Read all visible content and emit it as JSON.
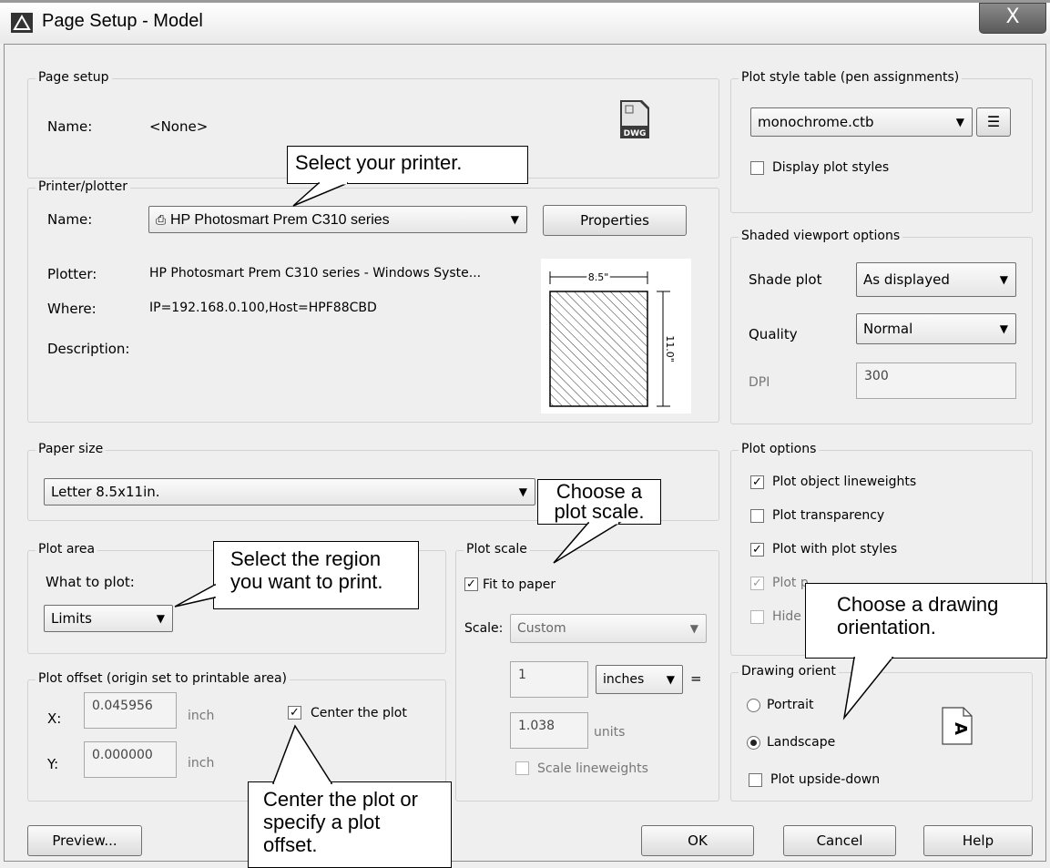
{
  "window": {
    "title": "Page Setup - Model",
    "close_label": "X"
  },
  "page_setup": {
    "legend": "Page setup",
    "name_label": "Name:",
    "name_value": "<None>",
    "dwg_label": "DWG"
  },
  "printer": {
    "legend": "Printer/plotter",
    "name_label": "Name:",
    "name_value": "HP Photosmart Prem C310 series",
    "properties_label": "Properties",
    "plotter_label": "Plotter:",
    "plotter_value": "HP Photosmart Prem C310 series - Windows Syste...",
    "where_label": "Where:",
    "where_value": "IP=192.168.0.100,Host=HPF88CBD",
    "description_label": "Description:",
    "preview_width": "8.5\"",
    "preview_height": "11.0\""
  },
  "paper_size": {
    "legend": "Paper size",
    "value": "Letter 8.5x11in."
  },
  "plot_area": {
    "legend": "Plot area",
    "what_label": "What to plot:",
    "value": "Limits"
  },
  "plot_offset": {
    "legend": "Plot offset (origin set to printable area)",
    "x_label": "X:",
    "x_value": "0.045956",
    "x_unit": "inch",
    "y_label": "Y:",
    "y_value": "0.000000",
    "y_unit": "inch",
    "center_label": "Center the plot",
    "center_checked": true
  },
  "plot_scale": {
    "legend": "Plot scale",
    "fit_label": "Fit to paper",
    "scale_label": "Scale:",
    "scale_value": "Custom",
    "num_value": "1",
    "unit_value": "inches",
    "equals": "=",
    "den_value": "1.038",
    "den_unit": "units",
    "lineweights_label": "Scale lineweights"
  },
  "plot_style_table": {
    "legend": "Plot style table (pen assignments)",
    "value": "monochrome.ctb",
    "display_label": "Display plot styles"
  },
  "shaded_viewport": {
    "legend": "Shaded viewport options",
    "shade_label": "Shade plot",
    "shade_value": "As displayed",
    "quality_label": "Quality",
    "quality_value": "Normal",
    "dpi_label": "DPI",
    "dpi_value": "300"
  },
  "plot_options": {
    "legend": "Plot options",
    "items": [
      "Plot object lineweights",
      "Plot transparency",
      "Plot with plot styles",
      "Plot p",
      "Hide "
    ]
  },
  "orientation": {
    "legend": "Drawing orient",
    "portrait_label": "Portrait",
    "landscape_label": "Landscape",
    "upside_label": "Plot upside-down",
    "icon_letter": "A"
  },
  "buttons": {
    "preview": "Preview...",
    "ok": "OK",
    "cancel": "Cancel",
    "help": "Help"
  },
  "callouts": {
    "printer": "Select your printer.",
    "scale": "Choose a plot scale.",
    "region": "Select the region you want to print.",
    "orientation": "Choose a drawing orientation.",
    "center": "Center the plot or specify a plot offset."
  }
}
